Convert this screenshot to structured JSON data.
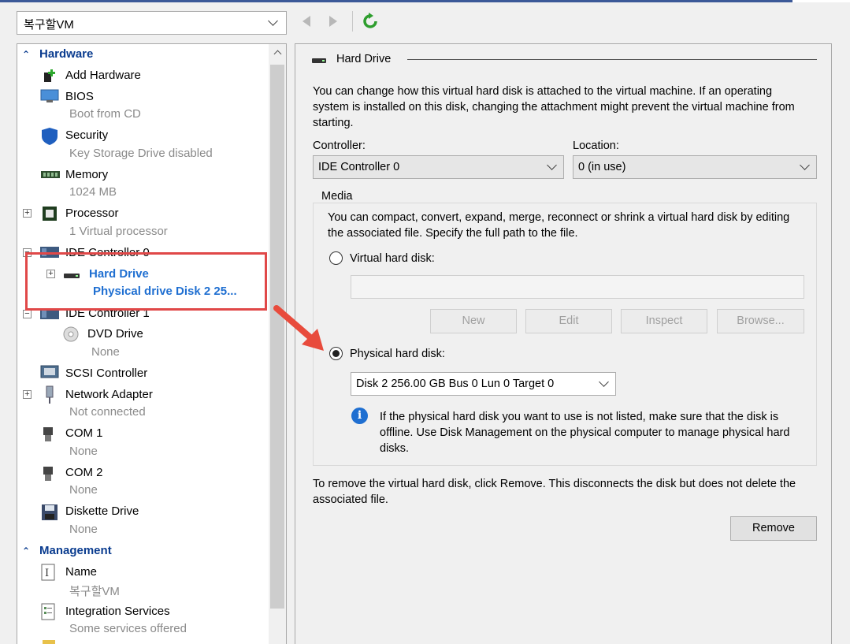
{
  "vm_selector": {
    "value": "복구할VM"
  },
  "tree": {
    "hardware_header": "Hardware",
    "items": {
      "add_hardware": {
        "label": "Add Hardware"
      },
      "bios": {
        "label": "BIOS",
        "sub": "Boot from CD"
      },
      "security": {
        "label": "Security",
        "sub": "Key Storage Drive disabled"
      },
      "memory": {
        "label": "Memory",
        "sub": "1024 MB"
      },
      "processor": {
        "label": "Processor",
        "sub": "1 Virtual processor"
      },
      "ide0": {
        "label": "IDE Controller 0"
      },
      "hard_drive": {
        "label": "Hard Drive",
        "sub": "Physical drive Disk 2 25..."
      },
      "ide1": {
        "label": "IDE Controller 1"
      },
      "dvd": {
        "label": "DVD Drive",
        "sub": "None"
      },
      "scsi": {
        "label": "SCSI Controller"
      },
      "network": {
        "label": "Network Adapter",
        "sub": "Not connected"
      },
      "com1": {
        "label": "COM 1",
        "sub": "None"
      },
      "com2": {
        "label": "COM 2",
        "sub": "None"
      },
      "diskette": {
        "label": "Diskette Drive",
        "sub": "None"
      }
    },
    "management_header": "Management",
    "mgmt_items": {
      "name": {
        "label": "Name",
        "sub": "복구할VM"
      },
      "integration": {
        "label": "Integration Services",
        "sub": "Some services offered"
      }
    }
  },
  "details": {
    "section_title": "Hard Drive",
    "intro": "You can change how this virtual hard disk is attached to the virtual machine. If an operating system is installed on this disk, changing the attachment might prevent the virtual machine from starting.",
    "controller_label": "Controller:",
    "controller_value": "IDE Controller 0",
    "location_label": "Location:",
    "location_value": "0 (in use)",
    "media_label": "Media",
    "media_desc": "You can compact, convert, expand, merge, reconnect or shrink a virtual hard disk by editing the associated file. Specify the full path to the file.",
    "virtual_disk_label": "Virtual hard disk:",
    "virtual_disk_path": "",
    "buttons": {
      "new": "New",
      "edit": "Edit",
      "inspect": "Inspect",
      "browse": "Browse..."
    },
    "physical_disk_label": "Physical hard disk:",
    "physical_disk_value": "Disk 2 256.00 GB Bus 0 Lun 0 Target 0",
    "info_text": "If the physical hard disk you want to use is not listed, make sure that the disk is offline. Use Disk Management on the physical computer to manage physical hard disks.",
    "remove_text": "To remove the virtual hard disk, click Remove. This disconnects the disk but does not delete the associated file.",
    "remove_button": "Remove"
  },
  "colors": {
    "accent": "#0a3c8f",
    "selected": "#1f6fd1",
    "highlight_box": "#e04848",
    "refresh": "#2e9e2e"
  }
}
